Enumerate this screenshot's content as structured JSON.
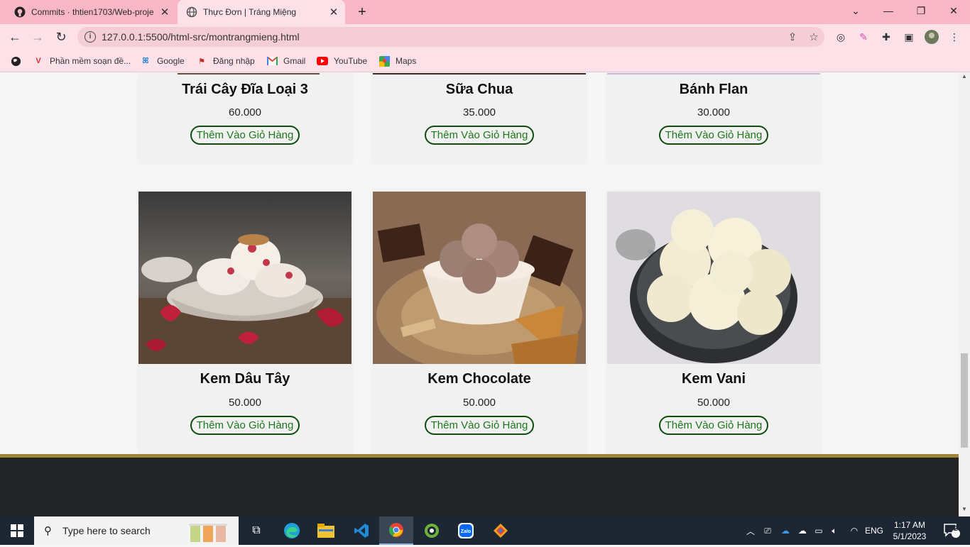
{
  "browser": {
    "tabs": [
      {
        "title": "Commits · thtien1703/Web-proje",
        "icon": "github-icon"
      },
      {
        "title": "Thực Đơn | Tráng Miệng",
        "icon": "globe-icon"
      }
    ],
    "url": "127.0.0.1:5500/html-src/montrangmieng.html",
    "bookmarks": [
      {
        "label": "Phần mềm soạn đề...",
        "icon": "v-logo-icon"
      },
      {
        "label": "Google",
        "icon": "google-icon"
      },
      {
        "label": "Đăng nhập",
        "icon": "login-icon"
      },
      {
        "label": "Gmail",
        "icon": "gmail-icon"
      },
      {
        "label": "YouTube",
        "icon": "youtube-icon"
      },
      {
        "label": "Maps",
        "icon": "maps-icon"
      }
    ]
  },
  "products_top": [
    {
      "name": "Trái Cây Đĩa Loại 3",
      "price": "60.000",
      "button": "Thêm Vào Giỏ Hàng"
    },
    {
      "name": "Sữa Chua",
      "price": "35.000",
      "button": "Thêm Vào Giỏ Hàng"
    },
    {
      "name": "Bánh Flan",
      "price": "30.000",
      "button": "Thêm Vào Giỏ Hàng"
    }
  ],
  "products_bottom": [
    {
      "name": "Kem Dâu Tây",
      "price": "50.000",
      "button": "Thêm Vào Giỏ Hàng",
      "image": "strawberry-ice-cream"
    },
    {
      "name": "Kem Chocolate",
      "price": "50.000",
      "button": "Thêm Vào Giỏ Hàng",
      "image": "chocolate-ice-cream"
    },
    {
      "name": "Kem Vani",
      "price": "50.000",
      "button": "Thêm Vào Giỏ Hàng",
      "image": "vanilla-ice-cream"
    }
  ],
  "taskbar": {
    "search_placeholder": "Type here to search",
    "language": "ENG",
    "time": "1:17 AM",
    "date": "5/1/2023",
    "notification_count": "2"
  },
  "colors": {
    "tabbar": "#f9b7c5",
    "toolbar": "#fde1e8",
    "button_border": "#0d4d0d",
    "button_text": "#1b7a1b",
    "footer": "#222426",
    "footer_border": "#a08238"
  }
}
